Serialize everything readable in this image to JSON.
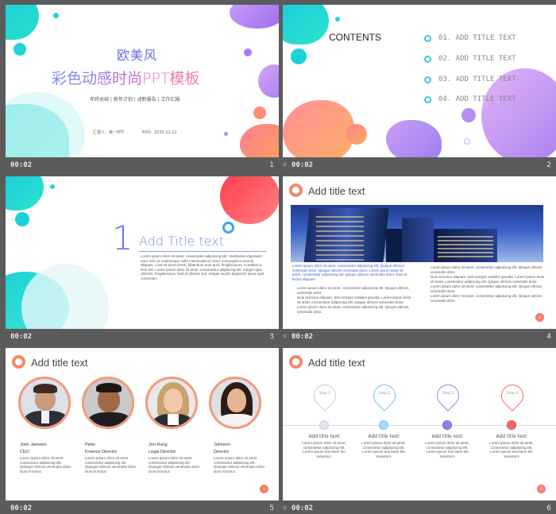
{
  "slides": [
    {
      "time": "00:02",
      "number": "1",
      "title_top": "欧美风",
      "title_main": "彩色动感时尚PPT模板",
      "subtitle": "年终总结 | 新年计划 | 述职报告 | 工作汇报",
      "reporter": "汇报人：第一PPT",
      "date": "时间：2030.12.12"
    },
    {
      "time": "00:02",
      "number": "2",
      "heading": "CONTENTS",
      "items": [
        "01. ADD TITLE TEXT",
        "02. ADD TITLE TEXT",
        "03. ADD TITLE TEXT",
        "04. ADD TITLE TEXT"
      ]
    },
    {
      "time": "00:02",
      "number": "3",
      "big_number": "1",
      "title": "Add Title text",
      "body": "Lorem ipsum dolor sit amet, consectetur adipiscing elit. Vestibulum dignissim nunc nisl, ac scelerisque nulla malesuada id. Nunc consequat a urna at aliquam. Cras sit amet lorem, bibendum eros quis, fringilla lacus. Curabitur a sem est. Lorem ipsum dolor sit amet, consectetur adipiscing elit. Integer quis ultricies, fringilla lacus. Sed ut ultrices sed. Integer iaculis dignissim lacus eget commodo."
    },
    {
      "time": "00:02",
      "number": "4",
      "title": "Add title text",
      "blue_text": "Lorem ipsum dolor sit amet, consectetur adipiscing elit. Quique ultrices venenatis dolor. Qisque ultrices venenatis dolor. Lorem ipsum dolor sit amet, consectetur adipiscing elit. Qisque ultrices venenatis dolor. Duis et lectus aliquam",
      "bullets_left": [
        "Lorem ipsum dolor sit amet, consectetur adipiscing elit. Qisque ultrices venenatis dolor.",
        "Duis at lectus aliquam. Sem tempor sodales gravida. Lorem ipsum dolor sit amet, consectetur adipiscing elit. Qisque ultrices venenatis dolor.",
        "Lorem ipsum dolor sit amet, consectetur adipiscing elit. Qisque ultrices venenatis dolor."
      ],
      "bullets_right": [
        "Lorem ipsum dolor sit amet, consectetur adipiscing elit. Qisque ultrices venenatis dolor.",
        "Duis at lectus aliquam. Sem tempor sodales gravida. Lorem ipsum dolor sit amet, consectetur adipiscing elit. Qisque ultrices venenatis dolor.",
        "Lorem ipsum dolor sit amet, consectetur adipiscing elit. Qisque ultrices venenatis dolor.",
        "Lorem ipsum dolor sit amet, consectetur adipiscing elit. Qisque ultrices venenatis dolor."
      ]
    },
    {
      "time": "00:02",
      "number": "5",
      "title": "Add title text",
      "people": [
        {
          "name": "Josh Janssen",
          "role": "CEO",
          "text": "Lorem ipsum dolor sit amet consectetur adipiscing elit. Quisque ultrices venenatis dolor. Duis et lectus"
        },
        {
          "name": "Peter",
          "role": "Finance Director",
          "text": "Lorem ipsum dolor sit amet consectetur adipiscing elit. Quisque ultrices venenatis dolor. Duis et lectus"
        },
        {
          "name": "Jun Rung",
          "role": "Legal Director",
          "text": "Lorem ipsum dolor sit amet consectetur adipiscing elit. Quisque ultrices venenatis dolor. Duis et lectus"
        },
        {
          "name": "Johnson",
          "role": "Director",
          "text": "Lorem ipsum dolor sit amet consectetur adipiscing elit. Quisque ultrices venenatis dolor. Duis et lectus"
        }
      ]
    },
    {
      "time": "00:02",
      "number": "6",
      "title": "Add title text",
      "steps": [
        {
          "label": "Step 1",
          "heading": "Add title text",
          "text": "Lorem ipsum dolor sit amet, consectetur adipiscing elit. Lorem Ipsum has been the industry's",
          "color": "#c9c9d6"
        },
        {
          "label": "Step 2",
          "heading": "Add title text",
          "text": "Lorem ipsum dolor sit amet, consectetur adipiscing elit. Lorem Ipsum has been the industry's",
          "color": "#6fc3ec"
        },
        {
          "label": "Step 3",
          "heading": "Add title text",
          "text": "Lorem ipsum dolor sit amet, consectetur adipiscing elit. Lorem Ipsum has been the industry's",
          "color": "#8a85e6"
        },
        {
          "label": "Step 4",
          "heading": "Add title text",
          "text": "Lorem ipsum dolor sit amet, consectetur adipiscing elit. Lorem Ipsum has been the industry's",
          "color": "#f06a6a"
        }
      ]
    }
  ],
  "colors": {
    "teal": "#1fd1d6",
    "purple": "#b07cf0",
    "coral": "#ff8a66",
    "accent_blue": "#5a73d8"
  }
}
